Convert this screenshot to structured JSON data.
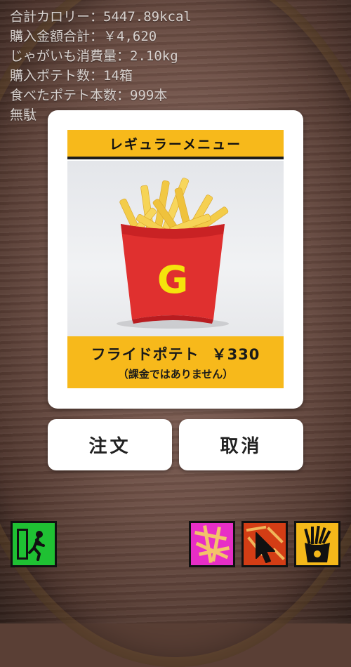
{
  "stats": {
    "total_calories": "合計カロリー：5447.89kcal",
    "total_spent": "購入金額合計：￥4,620",
    "potato_consumed": "じゃがいも消費量：2.10kg",
    "potatoes_bought": "購入ポテト数：14箱",
    "fries_eaten": "食べたポテト本数：999本",
    "wasted": "無駄"
  },
  "dialog": {
    "menu_title": "レギュラーメニュー",
    "item_name": "フライドポテト",
    "price": "￥330",
    "note": "（課金ではありません）",
    "box_logo": "G"
  },
  "buttons": {
    "order": "注文",
    "cancel": "取消"
  },
  "toolbar": {
    "exit_icon": "exit-door-icon",
    "magenta_icon": "scattered-fries-icon",
    "red_icon": "pointer-cursor-icon",
    "yellow_icon": "fries-box-icon"
  },
  "colors": {
    "menu_yellow": "#f7b91b",
    "exit_green": "#1fc133",
    "magenta": "#e72ec6",
    "red": "#d33d15",
    "yellow": "#f4b81a"
  }
}
